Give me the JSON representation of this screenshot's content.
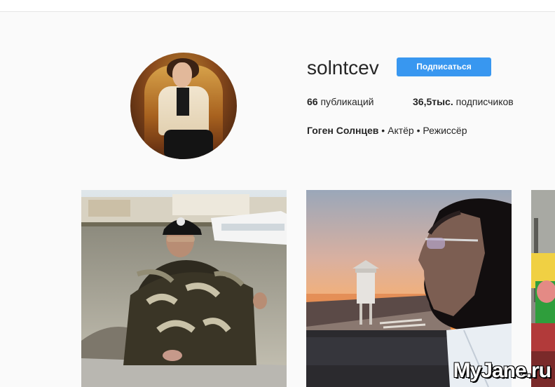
{
  "profile": {
    "username": "solntcev",
    "follow_label": "Подписаться",
    "posts_count": "66",
    "posts_label": "публикаций",
    "followers_count": "36,5тыс.",
    "followers_label": "подписчиков",
    "full_name": "Гоген Солнцев",
    "bio_rest": " • Актёр • Режиссёр"
  },
  "colors": {
    "accent": "#3897f0",
    "background": "#fafafa"
  },
  "posts": [
    {
      "name": "post-harbor-camo"
    },
    {
      "name": "post-sunset-profile"
    },
    {
      "name": "post-partial"
    }
  ],
  "watermark": "MyJane.ru"
}
